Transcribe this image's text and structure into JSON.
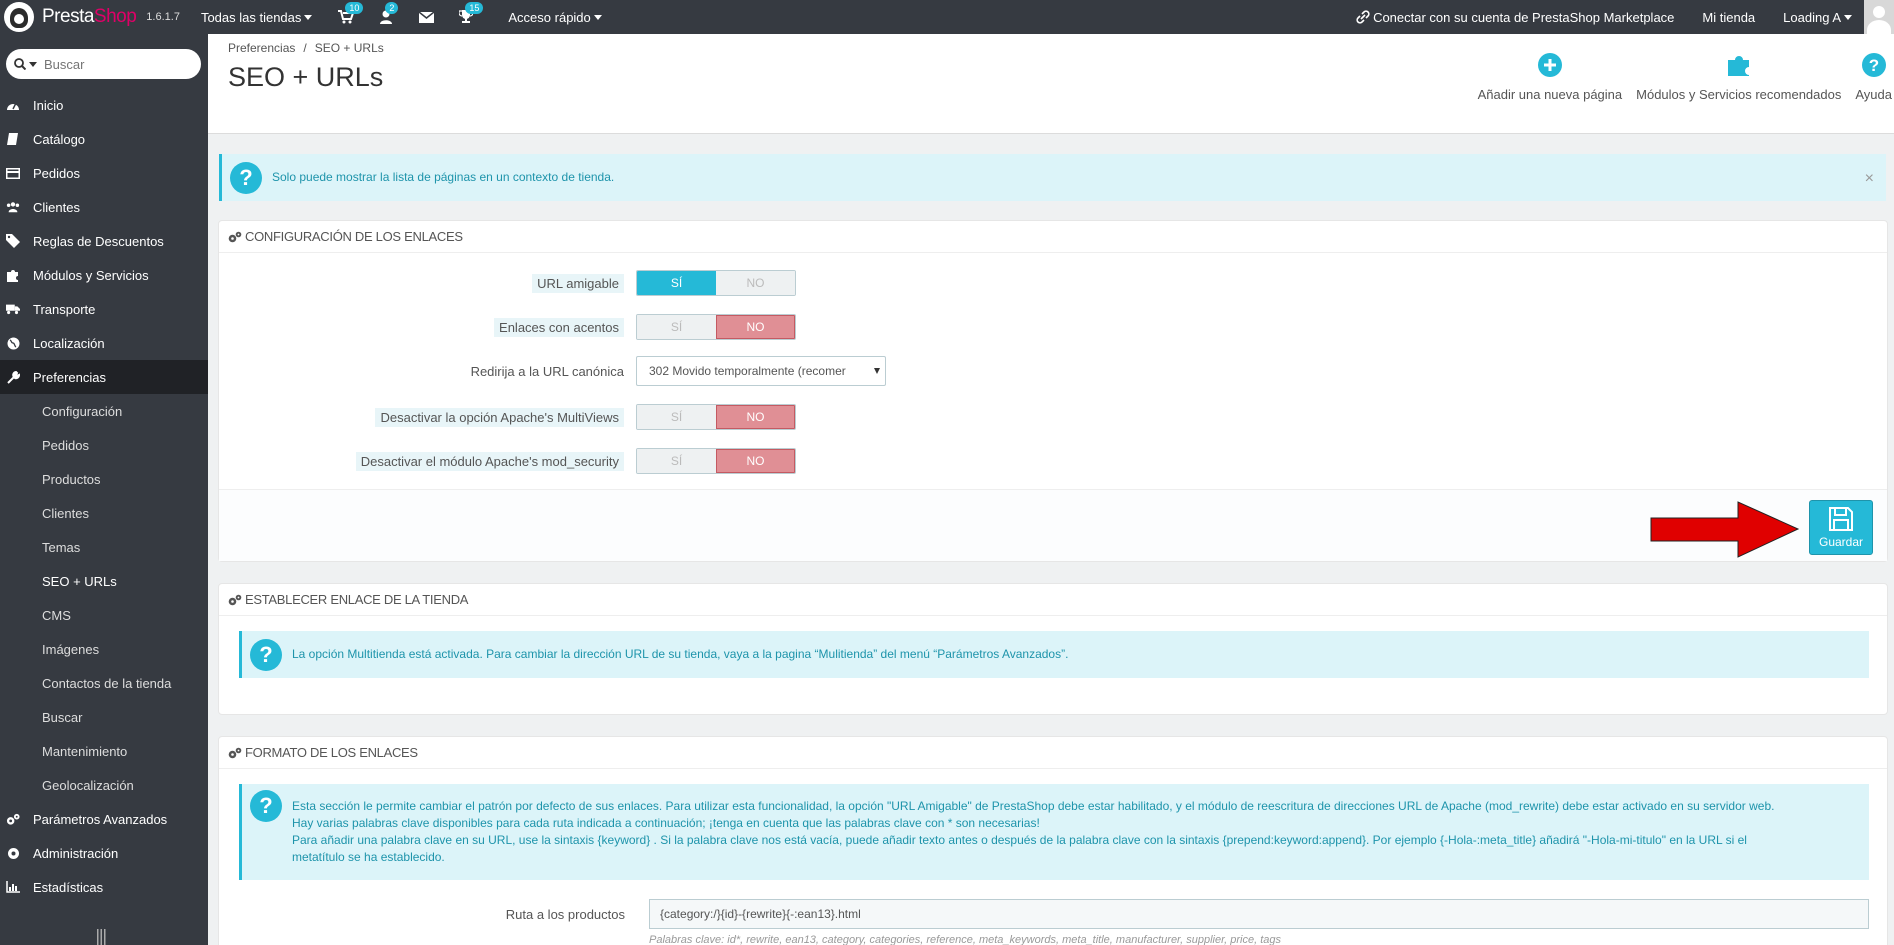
{
  "topbar": {
    "brand_part1": "Presta",
    "brand_part2": "Shop",
    "version": "1.6.1.7",
    "store_selector": "Todas las tiendas",
    "badges": {
      "orders": "10",
      "customers": "2",
      "trophies": "15"
    },
    "quick_access": "Acceso rápido",
    "marketplace": "Conectar con su cuenta de PrestaShop Marketplace",
    "my_store": "Mi tienda",
    "user": "Loading A"
  },
  "sidebar": {
    "search_placeholder": "Buscar",
    "items": [
      {
        "label": "Inicio",
        "icon": "dashboard-icon"
      },
      {
        "label": "Catálogo",
        "icon": "book-icon"
      },
      {
        "label": "Pedidos",
        "icon": "credit-card-icon"
      },
      {
        "label": "Clientes",
        "icon": "users-icon"
      },
      {
        "label": "Reglas de Descuentos",
        "icon": "tags-icon"
      },
      {
        "label": "Módulos y Servicios",
        "icon": "puzzle-icon"
      },
      {
        "label": "Transporte",
        "icon": "truck-icon"
      },
      {
        "label": "Localización",
        "icon": "globe-icon"
      },
      {
        "label": "Preferencias",
        "icon": "wrench-icon"
      }
    ],
    "sub_items": [
      "Configuración",
      "Pedidos",
      "Productos",
      "Clientes",
      "Temas",
      "SEO + URLs",
      "CMS",
      "Imágenes",
      "Contactos de la tienda",
      "Buscar",
      "Mantenimiento",
      "Geolocalización"
    ],
    "bottom_items": [
      {
        "label": "Parámetros Avanzados",
        "icon": "cogs-icon"
      },
      {
        "label": "Administración",
        "icon": "cog-icon"
      },
      {
        "label": "Estadísticas",
        "icon": "bar-chart-icon"
      }
    ]
  },
  "header": {
    "breadcrumb": [
      "Preferencias",
      "SEO + URLs"
    ],
    "title": "SEO + URLs",
    "toolbar": [
      "Añadir una nueva página",
      "Módulos y Servicios recomendados",
      "Ayuda"
    ]
  },
  "alert_context": "Solo puede mostrar la lista de páginas en un contexto de tienda.",
  "config_panel": {
    "heading": "CONFIGURACIÓN DE LOS ENLACES",
    "yes": "SÍ",
    "no": "NO",
    "friendly_url": {
      "label": "URL amigable",
      "value": "SÍ"
    },
    "accented": {
      "label": "Enlaces con acentos",
      "value": "NO"
    },
    "canonical": {
      "label": "Redirija a la URL canónica",
      "value": "302 Movido temporalmente (recomer"
    },
    "multiviews": {
      "label": "Desactivar la opción Apache's MultiViews",
      "value": "NO"
    },
    "mod_security": {
      "label": "Desactivar el módulo Apache's mod_security",
      "value": "NO"
    },
    "save": "Guardar"
  },
  "store_link_panel": {
    "heading": "ESTABLECER ENLACE DE LA TIENDA",
    "info": "La opción Multitienda está activada. Para cambiar la dirección URL de su tienda, vaya a la pagina “Mulitienda” del menú “Parámetros Avanzados”."
  },
  "format_panel": {
    "heading": "FORMATO DE LOS ENLACES",
    "info_lines": [
      "Esta sección le permite cambiar el patrón por defecto de sus enlaces. Para utilizar esta funcionalidad, la opción \"URL Amigable\" de PrestaShop debe estar habilitado, y el módulo de reescritura de direcciones URL de Apache (mod_rewrite) debe estar activado en su servidor web.",
      "Hay varias palabras clave disponibles para cada ruta indicada a continuación; ¡tenga en cuenta que las palabras clave con * son necesarias!",
      "Para añadir una palabra clave en su URL, use la sintaxis {keyword} . Si la palabra clave nos está vacía, puede añadir texto antes o después de la palabra clave con la sintaxis {prepend:keyword:append}. Por ejemplo {-Hola-:meta_title} añadirá \"-Hola-mi-titulo\" en la URL si el",
      "metatítulo se ha establecido."
    ],
    "product_route": {
      "label": "Ruta a los productos",
      "value": "{category:/}{id}-{rewrite}{-:ean13}.html"
    },
    "hint": "Palabras clave: id*, rewrite, ean13, category, categories, reference, meta_keywords, meta_title, manufacturer, supplier, price, tags"
  },
  "colors": {
    "topbar": "#363a41",
    "accent": "#25b9d7",
    "no_active": "#e08f95",
    "arrow": "#e00000"
  }
}
